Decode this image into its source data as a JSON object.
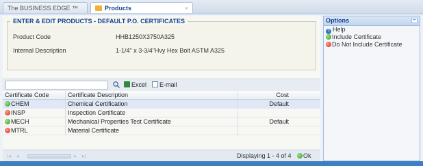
{
  "tabs": [
    {
      "label": "The BUSINESS EDGE ™"
    },
    {
      "label": "Products",
      "close": "×"
    }
  ],
  "form": {
    "title": "ENTER & EDIT PRODUCTS - DEFAULT P.O. CERTIFICATES",
    "fields": [
      {
        "label": "Product Code",
        "value": "HHB1250X3750A325"
      },
      {
        "label": "Internal Description",
        "value": "1-1/4\" x 3-3/4\"Hvy Hex Bolt ASTM A325"
      }
    ]
  },
  "toolbar": {
    "search_placeholder": "",
    "excel_label": "Excel",
    "email_label": "E-mail"
  },
  "grid": {
    "columns": [
      "Certificate Code",
      "Certificate Description",
      "Cost"
    ],
    "rows": [
      {
        "status": "included",
        "code": "CHEM",
        "description": "Chemical Certification",
        "cost": "Default"
      },
      {
        "status": "excluded",
        "code": "INSP",
        "description": "Inspection Certificate",
        "cost": ""
      },
      {
        "status": "included",
        "code": "MECH",
        "description": "Mechanical Properties Test Certificate",
        "cost": "Default"
      },
      {
        "status": "excluded",
        "code": "MTRL",
        "description": "Material Certificate",
        "cost": ""
      }
    ]
  },
  "pager": {
    "display_text": "Displaying 1 - 4 of 4",
    "ok_label": "Ok"
  },
  "options": {
    "title": "Options",
    "items": [
      {
        "icon": "help-icon",
        "label": "Help"
      },
      {
        "icon": "include-icon",
        "label": "Include Certificate"
      },
      {
        "icon": "exclude-icon",
        "label": "Do Not Include Certificate"
      }
    ]
  },
  "colors": {
    "header_blue": "#15428b",
    "included_green": "#2f9a24",
    "excluded_red": "#cc2a1a",
    "bottom_bar": "#3e7fc1"
  }
}
